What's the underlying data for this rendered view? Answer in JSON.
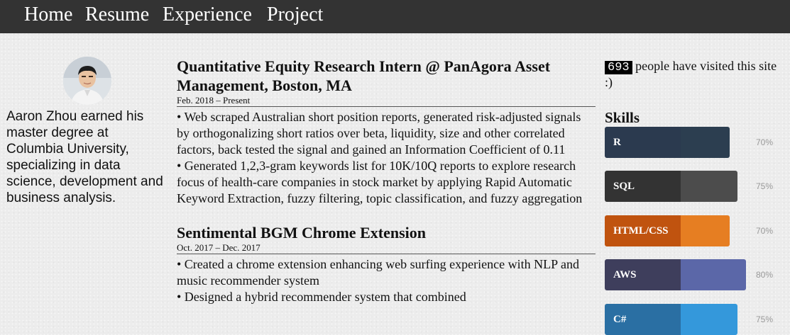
{
  "nav": {
    "items": [
      "Home",
      "Resume",
      "Experience",
      "Project"
    ]
  },
  "profile": {
    "bio": "Aaron Zhou earned his master degree at Columbia University, specializing in data science, development and business analysis."
  },
  "experience": [
    {
      "title": "Quantitative Equity Research Intern @ PanAgora Asset Management, Boston, MA",
      "date": "Feb. 2018 – Present",
      "bullets": [
        "• Web scraped Australian short position reports, generated risk-adjusted signals by orthogonalizing short ratios over beta, liquidity, size and other correlated factors, back tested the signal and gained an Information Coefficient of 0.11",
        "• Generated 1,2,3-gram keywords list for 10K/10Q reports to explore research focus of health-care companies in stock market by applying Rapid Automatic Keyword Extraction, fuzzy filtering, topic classification, and fuzzy aggregation"
      ]
    },
    {
      "title": "Sentimental BGM Chrome Extension",
      "date": "Oct. 2017 – Dec. 2017",
      "bullets": [
        "• Created a chrome extension enhancing web surfing experience with NLP and music recommender system",
        "• Designed a hybrid recommender system that combined"
      ]
    }
  ],
  "visits": {
    "count": "693",
    "text": " people have visited this site :)"
  },
  "skills": {
    "heading": "Skills",
    "items": [
      {
        "name": "R",
        "percent": "70%",
        "level": 0.7,
        "label_color": "#2b3a4f",
        "fill_color": "#2c3e50"
      },
      {
        "name": "SQL",
        "percent": "75%",
        "level": 0.75,
        "label_color": "#333333",
        "fill_color": "#4c4c4c"
      },
      {
        "name": "HTML/CSS",
        "percent": "70%",
        "level": 0.7,
        "label_color": "#c0530f",
        "fill_color": "#e67e22"
      },
      {
        "name": "AWS",
        "percent": "80%",
        "level": 0.8,
        "label_color": "#3e3e5c",
        "fill_color": "#5b67a8"
      },
      {
        "name": "C#",
        "percent": "75%",
        "level": 0.75,
        "label_color": "#2a6fa3",
        "fill_color": "#3498db"
      }
    ]
  }
}
